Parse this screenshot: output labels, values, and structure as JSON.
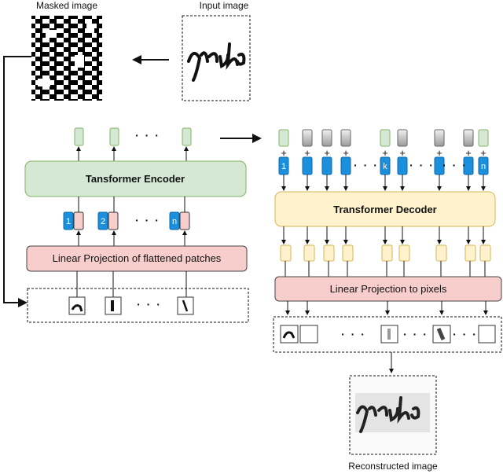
{
  "labels": {
    "masked_image": "Masked image",
    "input_image": "Input image",
    "reconstructed_image": "Reconstructed image"
  },
  "encoder": {
    "title": "Tansformer Encoder",
    "projection": "Linear Projection of flattened patches",
    "position_tokens": [
      "1",
      "2",
      "n"
    ]
  },
  "decoder": {
    "title": "Transformer Decoder",
    "projection": "Linear Projection to pixels",
    "position_tokens": [
      "1",
      "k",
      "n"
    ],
    "plus": "+"
  },
  "ellipsis": "· · ·",
  "colors": {
    "encoder_fill": "#d5e8d4",
    "encoder_border": "#82b366",
    "decoder_fill": "#fff2cc",
    "decoder_border": "#d6b656",
    "projection_fill": "#f8cecc",
    "position_token": "#1b8fdc",
    "mask_token": "#a0a0a0"
  }
}
